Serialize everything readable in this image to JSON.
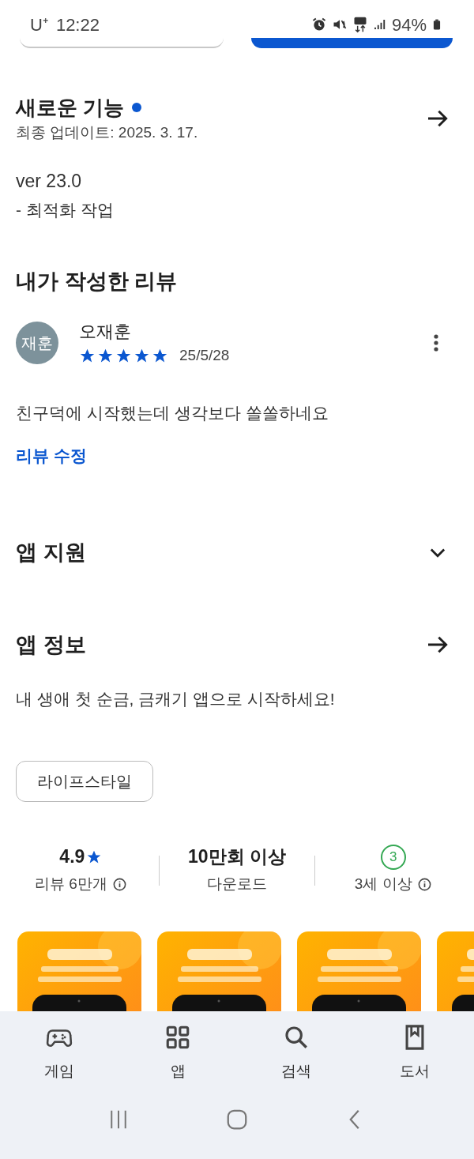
{
  "status_bar": {
    "carrier": "U⁺",
    "time": "12:22",
    "battery": "94%"
  },
  "whats_new": {
    "title": "새로운 기능",
    "updated": "최종 업데이트: 2025. 3. 17.",
    "version": "ver 23.0",
    "notes": "- 최적화 작업"
  },
  "my_review": {
    "title": "내가 작성한 리뷰",
    "avatar": "재훈",
    "author": "오재훈",
    "stars": 5,
    "date": "25/5/28",
    "text": "친구덕에 시작했는데 생각보다 쏠쏠하네요",
    "edit_link": "리뷰 수정"
  },
  "app_support": {
    "title": "앱 지원",
    "expanded": false
  },
  "app_info": {
    "title": "앱 정보",
    "description": "내 생애 첫 순금, 금캐기 앱으로 시작하세요!",
    "category": "라이프스타일"
  },
  "stats": [
    {
      "kind": "rating",
      "value": "4.9",
      "label": "리뷰 6만개"
    },
    {
      "kind": "downloads",
      "value": "10만회 이상",
      "label": "다운로드"
    },
    {
      "kind": "age",
      "value": "3",
      "label": "3세 이상"
    }
  ],
  "bottom_nav": [
    {
      "kind": "games",
      "label": "게임"
    },
    {
      "kind": "apps",
      "label": "앱"
    },
    {
      "kind": "search",
      "label": "검색"
    },
    {
      "kind": "books",
      "label": "도서"
    }
  ]
}
